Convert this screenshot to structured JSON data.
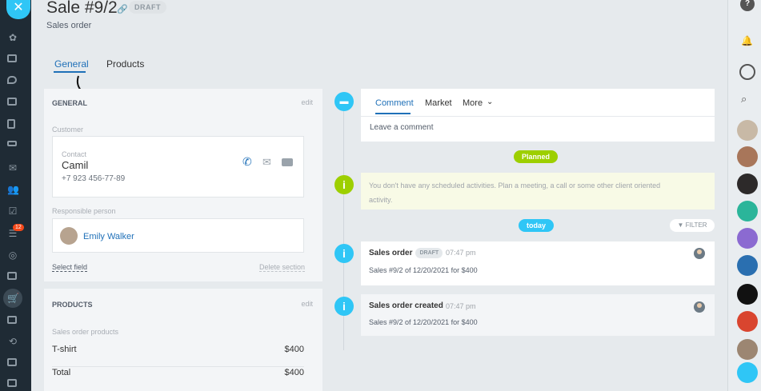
{
  "header": {
    "title": "Sale #9/2",
    "draft_badge": "DRAFT",
    "subtitle": "Sales order"
  },
  "tabs": [
    {
      "label": "General",
      "active": true
    },
    {
      "label": "Products",
      "active": false
    }
  ],
  "general": {
    "heading": "GENERAL",
    "edit_label": "edit",
    "customer_label": "Customer",
    "contact_label": "Contact",
    "contact_name": "Camil",
    "contact_phone": "+7 923 456-77-89",
    "responsible_label": "Responsible person",
    "responsible_name": "Emily Walker",
    "select_field": "Select field",
    "delete_section": "Delete section"
  },
  "products": {
    "heading": "PRODUCTS",
    "edit_label": "edit",
    "subheading": "Sales order products",
    "rows": [
      {
        "name": "T-shirt",
        "price": "$400"
      },
      {
        "name": "Total",
        "price": "$400"
      }
    ]
  },
  "composer": {
    "tabs": [
      "Comment",
      "Market",
      "More"
    ],
    "placeholder": "Leave a comment"
  },
  "timeline": {
    "planned_pill": "Planned",
    "planned_text": "You don't have any scheduled activities. Plan a meeting, a call or some other client oriented activity.",
    "today_pill": "today",
    "filter_label": "FILTER",
    "events": [
      {
        "title": "Sales order",
        "badge": "DRAFT",
        "time": "07:47 pm",
        "text": "Sales #9/2 of 12/20/2021 for $400"
      },
      {
        "title": "Sales order created",
        "time": "07:47 pm",
        "text": "Sales #9/2 of 12/20/2021 for $400"
      }
    ]
  },
  "sidebar": {
    "counter": "12"
  },
  "colors": {
    "accent": "#2fc6f6",
    "link": "#1f70b8",
    "planned": "#9dcf00",
    "today": "#2fc6f6",
    "sidebar_bg": "#1f2b35"
  }
}
